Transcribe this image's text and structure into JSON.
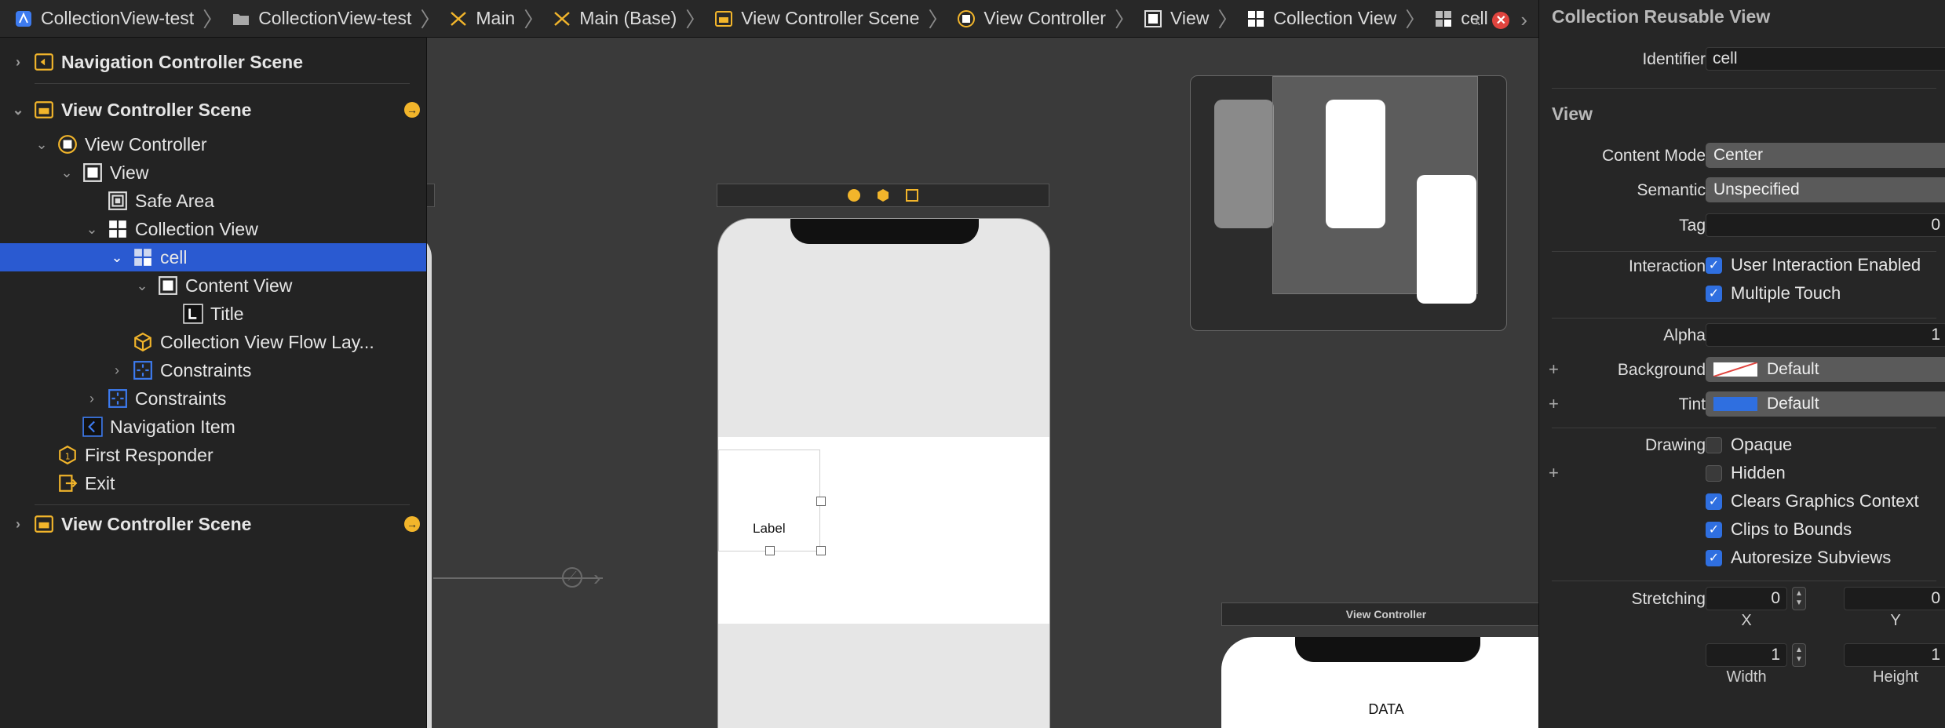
{
  "jumpbar": {
    "crumbs": [
      {
        "label": "CollectionView-test",
        "icon": "project-icon"
      },
      {
        "label": "CollectionView-test",
        "icon": "folder-icon"
      },
      {
        "label": "Main",
        "icon": "storyboard-icon"
      },
      {
        "label": "Main (Base)",
        "icon": "storyboard-icon"
      },
      {
        "label": "View Controller Scene",
        "icon": "scene-icon"
      },
      {
        "label": "View Controller",
        "icon": "view-controller-icon"
      },
      {
        "label": "View",
        "icon": "view-icon"
      },
      {
        "label": "Collection View",
        "icon": "collection-view-icon"
      },
      {
        "label": "cell",
        "icon": "cell-icon"
      }
    ]
  },
  "outline": {
    "rows": [
      {
        "label": "Navigation Controller Scene",
        "icon": "scene-icon",
        "disclosure": "collapsed",
        "bold": true
      },
      {
        "label": "View Controller Scene",
        "icon": "scene-icon",
        "disclosure": "expanded",
        "bold": true
      },
      {
        "label": "View Controller",
        "icon": "view-controller-icon",
        "disclosure": "expanded"
      },
      {
        "label": "View",
        "icon": "view-icon",
        "disclosure": "expanded"
      },
      {
        "label": "Safe Area",
        "icon": "safe-area-icon",
        "disclosure": "none"
      },
      {
        "label": "Collection View",
        "icon": "collection-view-icon",
        "disclosure": "expanded"
      },
      {
        "label": "cell",
        "icon": "cell-icon",
        "disclosure": "expanded",
        "selected": true
      },
      {
        "label": "Content View",
        "icon": "view-icon",
        "disclosure": "expanded"
      },
      {
        "label": "Title",
        "icon": "label-icon",
        "disclosure": "none"
      },
      {
        "label": "Collection View Flow Lay...",
        "icon": "flow-layout-icon",
        "disclosure": "none"
      },
      {
        "label": "Constraints",
        "icon": "constraints-icon",
        "disclosure": "collapsed"
      },
      {
        "label": "Constraints",
        "icon": "constraints-icon",
        "disclosure": "collapsed"
      },
      {
        "label": "Navigation Item",
        "icon": "navigation-item-icon",
        "disclosure": "none"
      },
      {
        "label": "First Responder",
        "icon": "first-responder-icon",
        "disclosure": "none"
      },
      {
        "label": "Exit",
        "icon": "exit-icon",
        "disclosure": "none"
      },
      {
        "label": "View Controller Scene",
        "icon": "scene-icon",
        "disclosure": "collapsed",
        "bold": true
      }
    ]
  },
  "canvas": {
    "cell_label": "Label",
    "second_scene_title": "View Controller",
    "second_scene_text": "DATA"
  },
  "inspector": {
    "section_title": "Collection Reusable View",
    "identifier_label": "Identifier",
    "identifier_value": "cell",
    "view_title": "View",
    "content_mode_label": "Content Mode",
    "content_mode_value": "Center",
    "semantic_label": "Semantic",
    "semantic_value": "Unspecified",
    "tag_label": "Tag",
    "tag_value": "0",
    "interaction_label": "Interaction",
    "user_interaction": {
      "label": "User Interaction Enabled",
      "checked": true
    },
    "multiple_touch": {
      "label": "Multiple Touch",
      "checked": true
    },
    "alpha_label": "Alpha",
    "alpha_value": "1",
    "background_label": "Background",
    "background_value": "Default",
    "tint_label": "Tint",
    "tint_value": "Default",
    "tint_color": "#2f6fe0",
    "drawing_label": "Drawing",
    "opaque": {
      "label": "Opaque",
      "checked": false
    },
    "hidden": {
      "label": "Hidden",
      "checked": false
    },
    "clears_graphics": {
      "label": "Clears Graphics Context",
      "checked": true
    },
    "clips_to_bounds": {
      "label": "Clips to Bounds",
      "checked": true
    },
    "autoresize": {
      "label": "Autoresize Subviews",
      "checked": true
    },
    "stretching_label": "Stretching",
    "stretch_x": "0",
    "stretch_y": "0",
    "stretch_width": "1",
    "stretch_height": "1",
    "x_label": "X",
    "y_label": "Y",
    "width_label": "Width",
    "height_label": "Height"
  },
  "colors": {
    "selection": "#2a5ad1",
    "accent": "#2f6fe0",
    "scene_badge": "#f2b52b",
    "error": "#e0443e"
  }
}
